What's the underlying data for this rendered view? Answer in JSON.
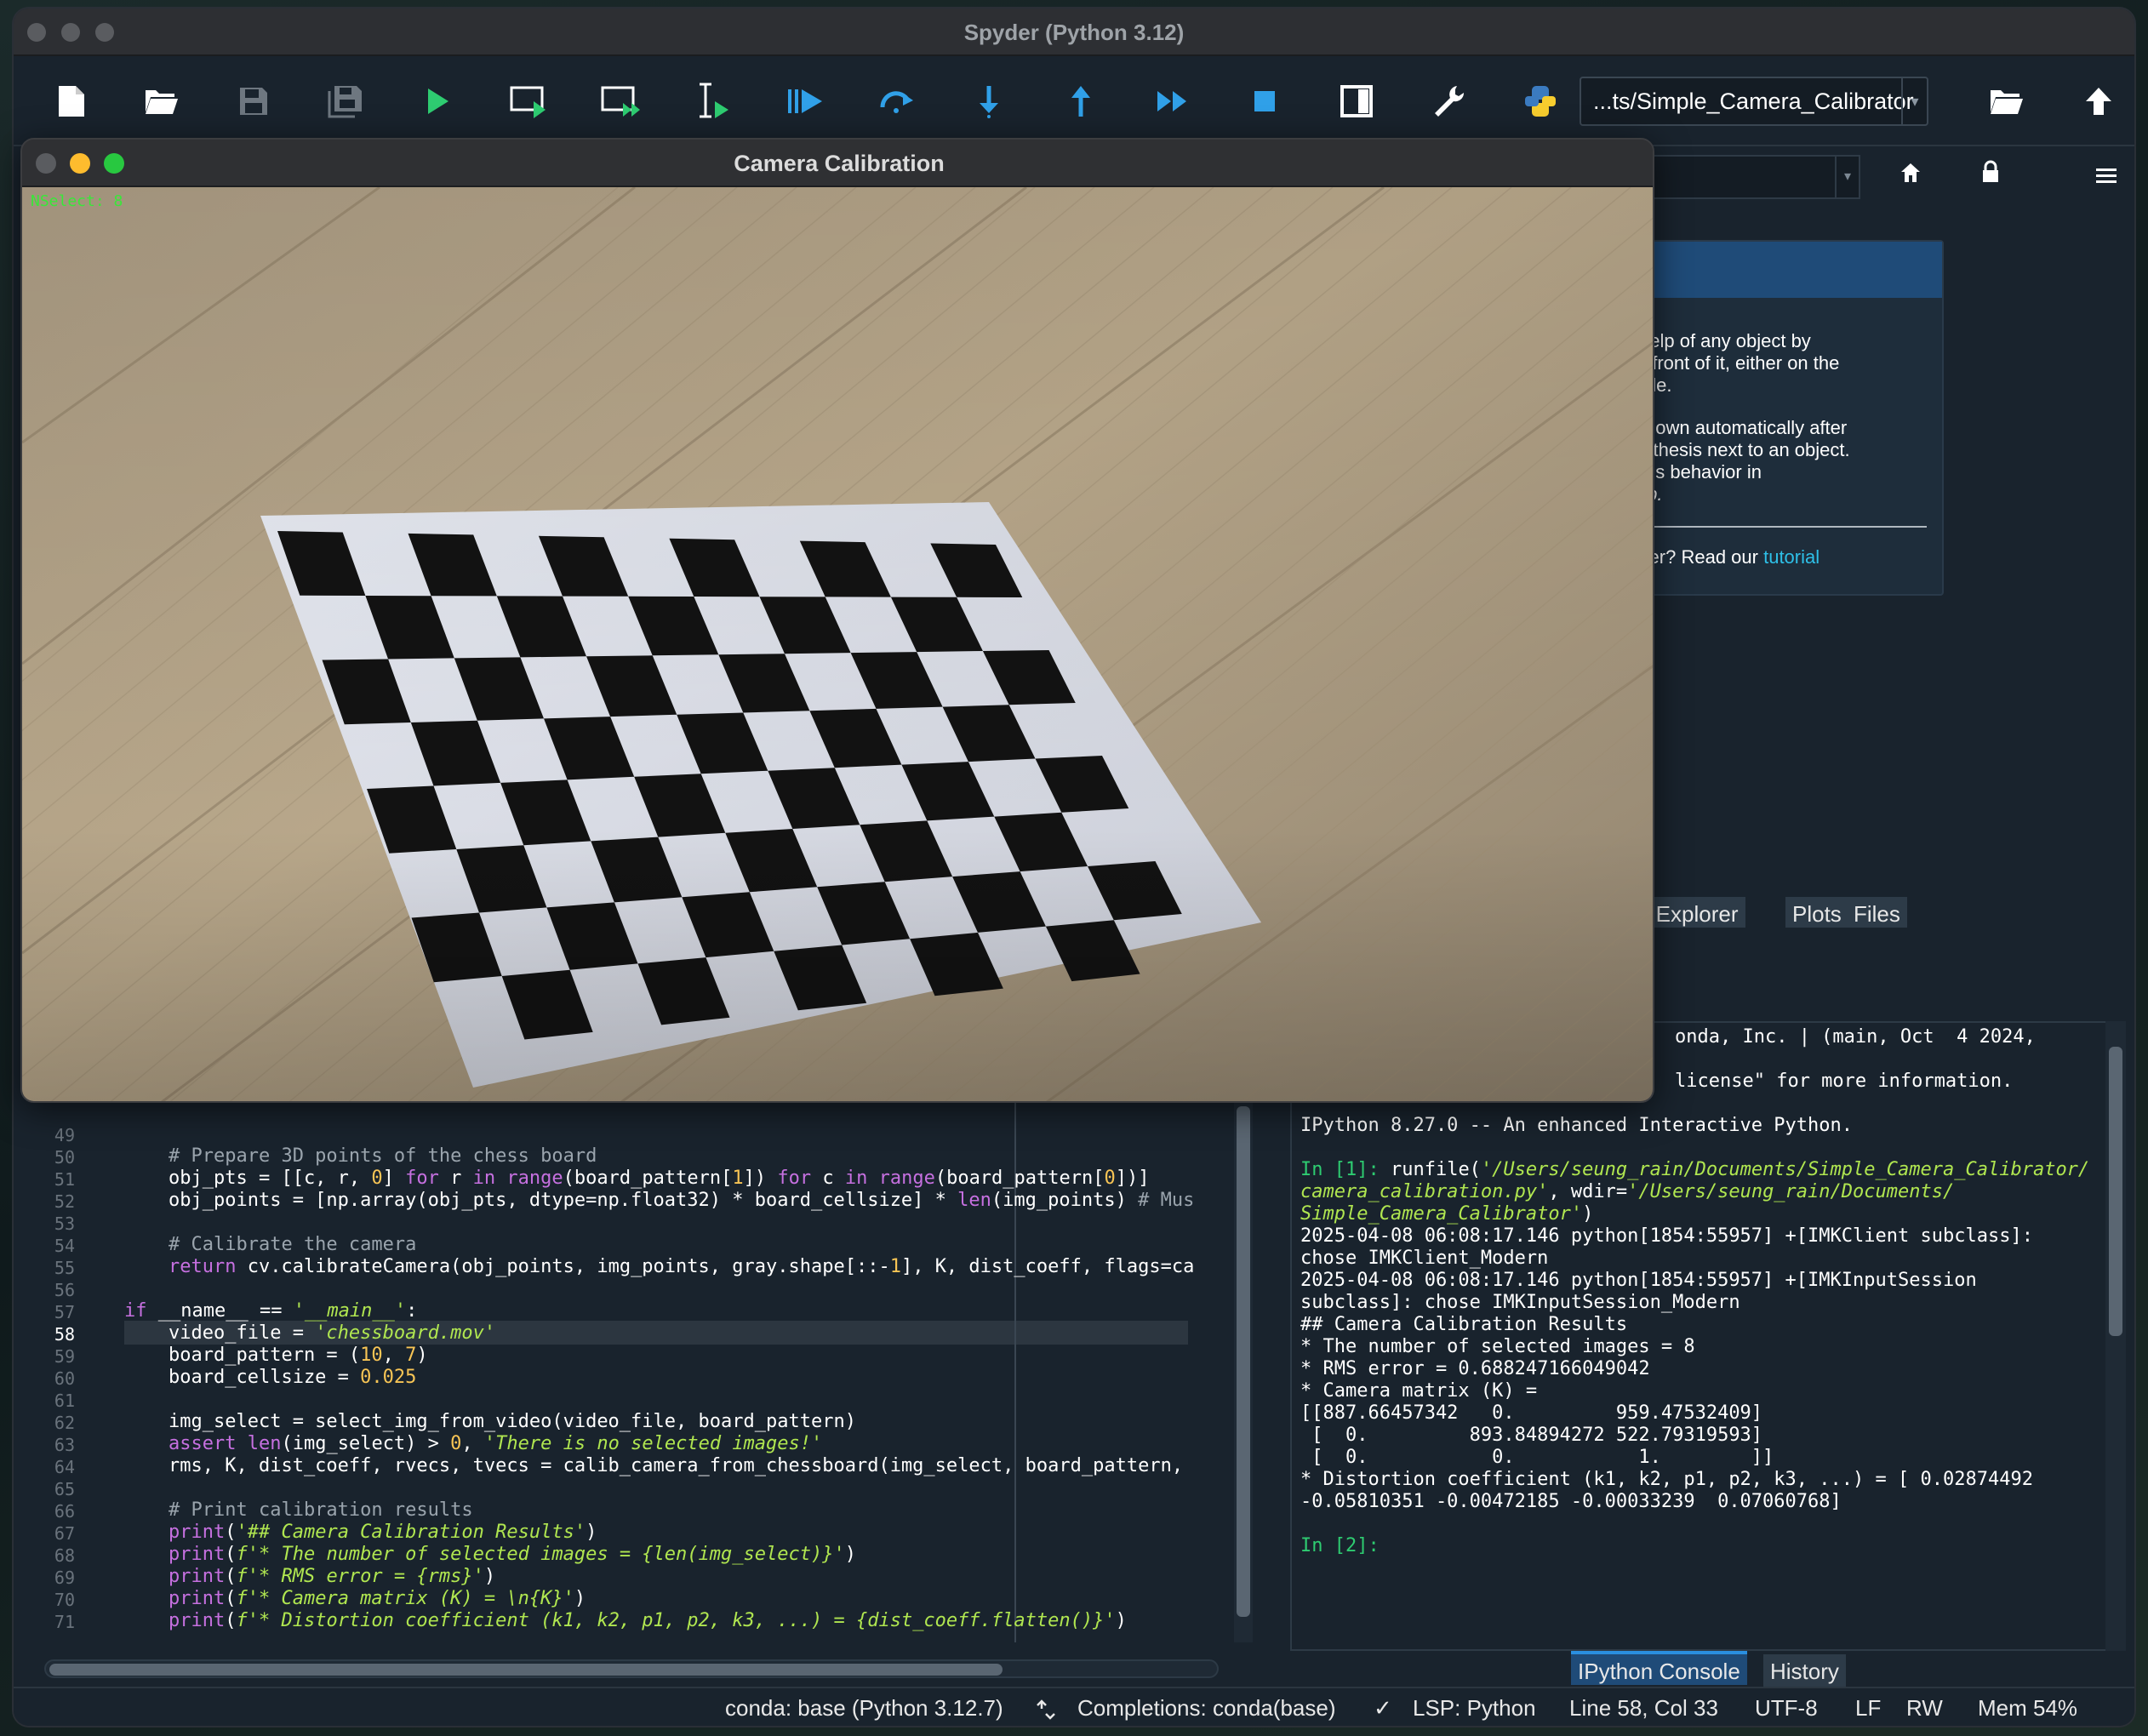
{
  "app": {
    "window_title": "Spyder (Python 3.12)",
    "working_dir": "...ts/Simple_Camera_Calibrator"
  },
  "toolbar": {
    "icons": [
      "new-file-icon",
      "open-file-icon",
      "save-icon",
      "save-all-icon",
      "run-icon",
      "run-cell-icon",
      "run-cell-advance-icon",
      "run-selection-icon",
      "debug-icon",
      "step-icon",
      "step-into-icon",
      "step-return-icon",
      "continue-icon",
      "stop-icon",
      "maximize-pane-icon",
      "preferences-icon",
      "python-path-icon"
    ]
  },
  "help_pane": {
    "lines": [
      "help of any object by",
      "in front of it, either on the",
      "sole.",
      "shown automatically after",
      "enthesis next to an object.",
      "this behavior in",
      "elp."
    ],
    "read_prefix": "rder? Read our ",
    "tutorial_link": "tutorial"
  },
  "top_tabs": [
    "e Explorer",
    "Plots",
    "Files"
  ],
  "camera_window": {
    "title": "Camera Calibration",
    "overlay": "NSelect: 8"
  },
  "editor": {
    "current_line": 58
  },
  "console": {
    "banner1": "onda, Inc. | (main, Oct  4 2024,",
    "banner2": "license\" for more information.",
    "banner3": "IPython 8.27.0 -- An enhanced Interactive Python.",
    "in1_prompt": "In [1]: ",
    "in1_cmd": "runfile(",
    "in1_path1": "'/Users/seung_rain/Documents/Simple_Camera_Calibrator/",
    "in1_path2": "camera_calibration.py'",
    "in1_wdir": ", wdir=",
    "in1_path3": "'/Users/seung_rain/Documents/",
    "in1_path4": "Simple_Camera_Calibrator'",
    "in1_close": ")",
    "out_lines": [
      "2025-04-08 06:08:17.146 python[1854:55957] +[IMKClient subclass]:",
      "chose IMKClient_Modern",
      "2025-04-08 06:08:17.146 python[1854:55957] +[IMKInputSession",
      "subclass]: chose IMKInputSession_Modern",
      "## Camera Calibration Results",
      "* The number of selected images = 8",
      "* RMS error = 0.688247166049042",
      "* Camera matrix (K) =",
      "[[887.66457342   0.         959.47532409]",
      " [  0.         893.84894272 522.79319593]",
      " [  0.           0.           1.        ]]",
      "* Distortion coefficient (k1, k2, p1, p2, k3, ...) = [ 0.02874492",
      "-0.05810351 -0.00472185 -0.00033239  0.07060768]"
    ],
    "in2_prompt": "In [2]:"
  },
  "bottom_tabs": [
    "IPython Console",
    "History"
  ],
  "statusbar": {
    "env": "conda: base (Python 3.12.7)",
    "completions": "Completions: conda(base)",
    "lsp": "LSP: Python",
    "position": "Line 58, Col 33",
    "encoding": "UTF-8",
    "eol": "LF",
    "rw": "RW",
    "mem": "Mem 54%"
  },
  "colors": {
    "accent": "#1f4b78",
    "prompt_green": "#2ecc71",
    "string_green": "#b0e650",
    "keyword_purple": "#c670e0",
    "number_yellow": "#f8c555"
  }
}
